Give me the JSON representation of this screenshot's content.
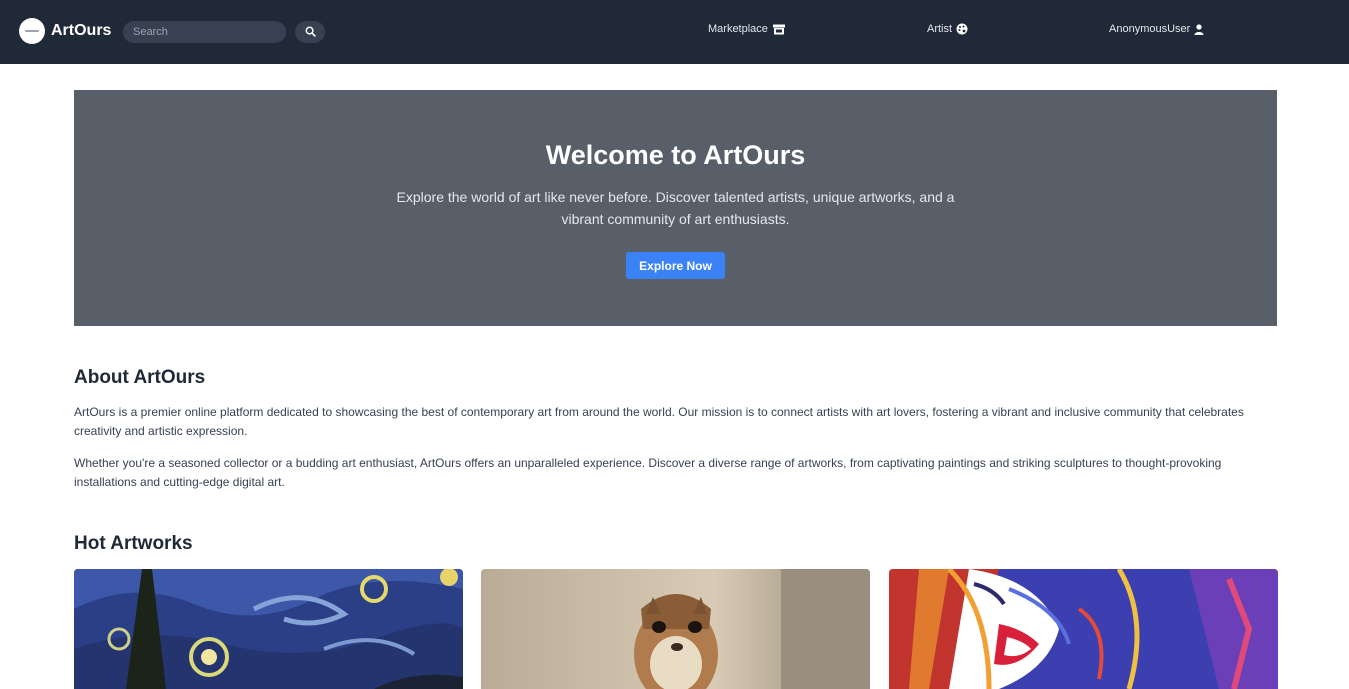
{
  "header": {
    "brand": "ArtOurs",
    "search_placeholder": "Search",
    "nav": {
      "marketplace": "Marketplace",
      "artist": "Artist",
      "user": "AnonymousUser"
    }
  },
  "hero": {
    "title": "Welcome to ArtOurs",
    "text": "Explore the world of art like never before. Discover talented artists, unique artworks, and a vibrant community of art enthusiasts.",
    "button": "Explore Now"
  },
  "about": {
    "title": "About ArtOurs",
    "p1": "ArtOurs is a premier online platform dedicated to showcasing the best of contemporary art from around the world. Our mission is to connect artists with art lovers, fostering a vibrant and inclusive community that celebrates creativity and artistic expression.",
    "p2": "Whether you're a seasoned collector or a budding art enthusiast, ArtOurs offers an unparalleled experience. Discover a diverse range of artworks, from captivating paintings and striking sculptures to thought-provoking installations and cutting-edge digital art."
  },
  "hot": {
    "title": "Hot Artworks"
  },
  "icons": {
    "search": "search-icon",
    "marketplace": "store-icon",
    "artist": "palette-icon",
    "user": "user-icon"
  },
  "colors": {
    "navbar": "#1f2937",
    "hero_bg": "#595f68",
    "accent": "#3b82f6"
  }
}
